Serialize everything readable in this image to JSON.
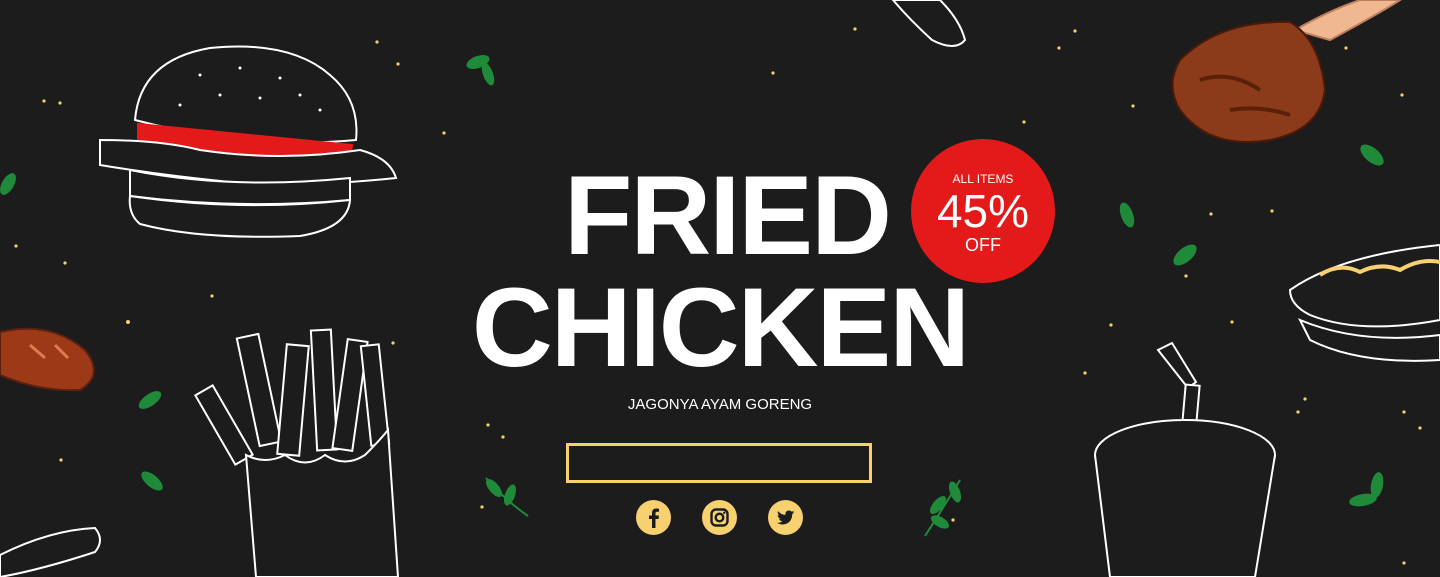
{
  "banner": {
    "title_line1": "FRIED",
    "title_line2": "CHICKEN",
    "subtitle": "JAGONYA AYAM GORENG",
    "badge": {
      "label": "ALL ITEMS",
      "value": "45%",
      "suffix": "OFF"
    },
    "cta_label": ""
  },
  "socials": [
    {
      "name": "facebook-icon"
    },
    {
      "name": "instagram-icon"
    },
    {
      "name": "twitter-icon"
    }
  ],
  "colors": {
    "background": "#1c1c1c",
    "text": "#ffffff",
    "accent": "#f7d070",
    "badge": "#e41a1a",
    "leaf": "#1f8a3a"
  }
}
